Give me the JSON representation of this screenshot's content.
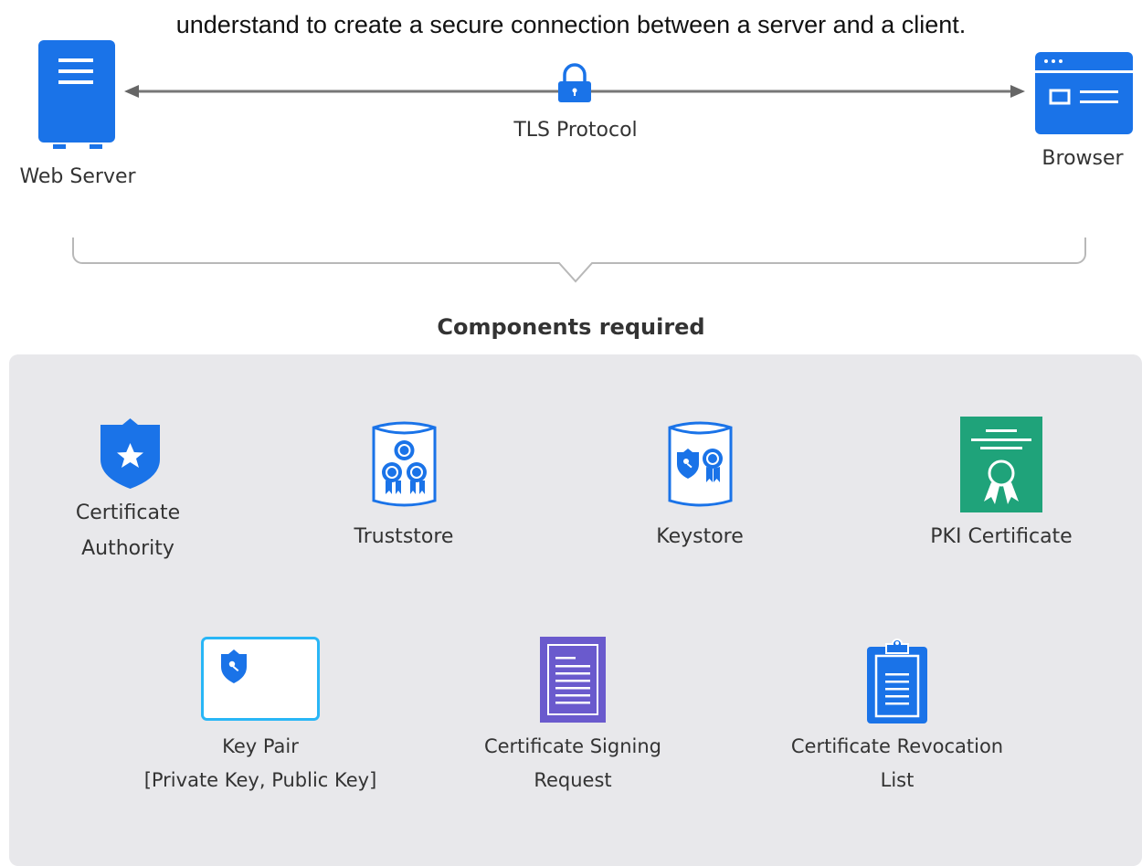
{
  "intro_text": "understand to create a secure connection between a server and a client.",
  "connection": {
    "left_node": "Web Server",
    "right_node": "Browser",
    "protocol": "TLS Protocol"
  },
  "section_title": "Components required",
  "components": [
    {
      "label": "Certificate Authority",
      "line1": "Certificate",
      "line2": "Authority",
      "icon": "shield-star-icon"
    },
    {
      "label": "Truststore",
      "icon": "truststore-cylinder-icon"
    },
    {
      "label": "Keystore",
      "icon": "keystore-cylinder-icon"
    },
    {
      "label": "PKI Certificate",
      "icon": "certificate-document-icon"
    },
    {
      "line1": "Key Pair",
      "line2": "[Private Key, Public Key]",
      "icon": "key-pair-icon"
    },
    {
      "line1": "Certificate Signing",
      "line2": "Request",
      "icon": "document-lines-icon"
    },
    {
      "line1": "Certificate Revocation",
      "line2": "List",
      "icon": "clipboard-list-icon"
    }
  ],
  "colors": {
    "blue": "#1a73e8",
    "light_blue": "#29b6f6",
    "green": "#1fa37a",
    "purple": "#6a5acd",
    "panel": "#e8e8eb",
    "line": "#777777"
  }
}
